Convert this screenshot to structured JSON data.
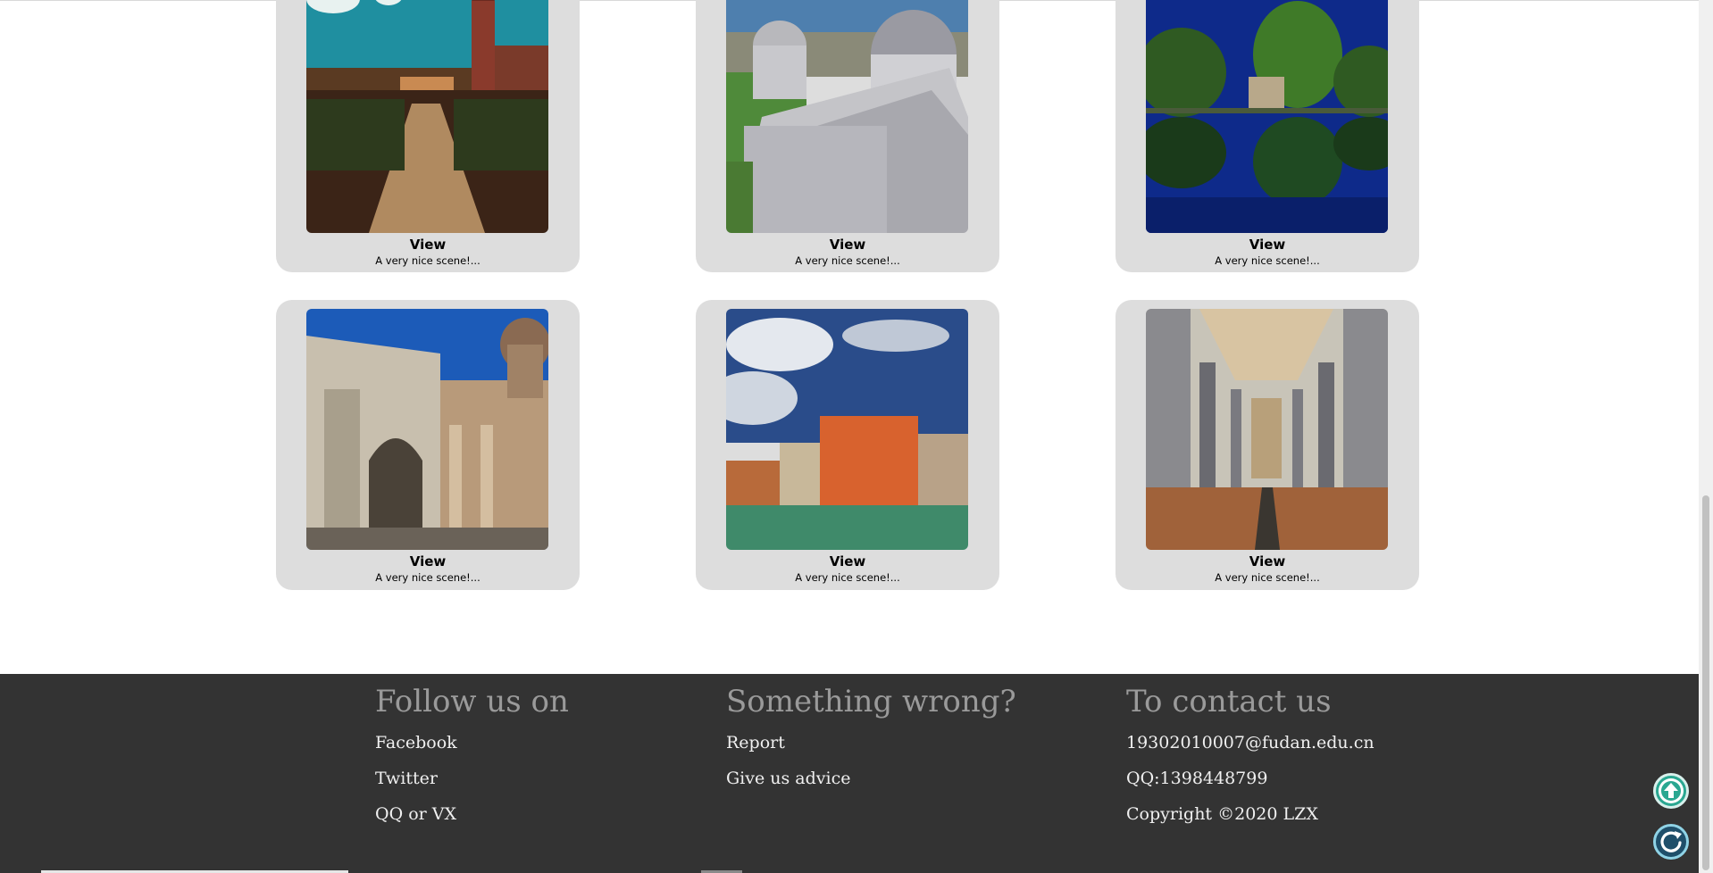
{
  "gallery": {
    "cards": [
      {
        "view_label": "View",
        "description": "A very nice scene!..."
      },
      {
        "view_label": "View",
        "description": "A very nice scene!..."
      },
      {
        "view_label": "View",
        "description": "A very nice scene!..."
      },
      {
        "view_label": "View",
        "description": "A very nice scene!..."
      },
      {
        "view_label": "View",
        "description": "A very nice scene!..."
      },
      {
        "view_label": "View",
        "description": "A very nice scene!..."
      }
    ]
  },
  "footer": {
    "follow": {
      "heading": "Follow us on",
      "links": [
        "Facebook",
        "Twitter",
        "QQ or VX"
      ]
    },
    "wrong": {
      "heading": "Something wrong?",
      "links": [
        "Report",
        "Give us advice"
      ]
    },
    "contact": {
      "heading": "To contact us",
      "lines": [
        "19302010007@fudan.edu.cn",
        "QQ:1398448799",
        "Copyright ©2020 LZX"
      ]
    }
  },
  "colors": {
    "card_bg": "#dddddd",
    "footer_bg": "#333333",
    "footer_heading": "#9a9a9a",
    "footer_link": "#f0f0f0",
    "back_to_top": "#2aa791",
    "refresh": "#1f4f6a"
  },
  "icons": {
    "back_to_top": "arrow-up-circle-icon",
    "refresh": "refresh-icon"
  }
}
